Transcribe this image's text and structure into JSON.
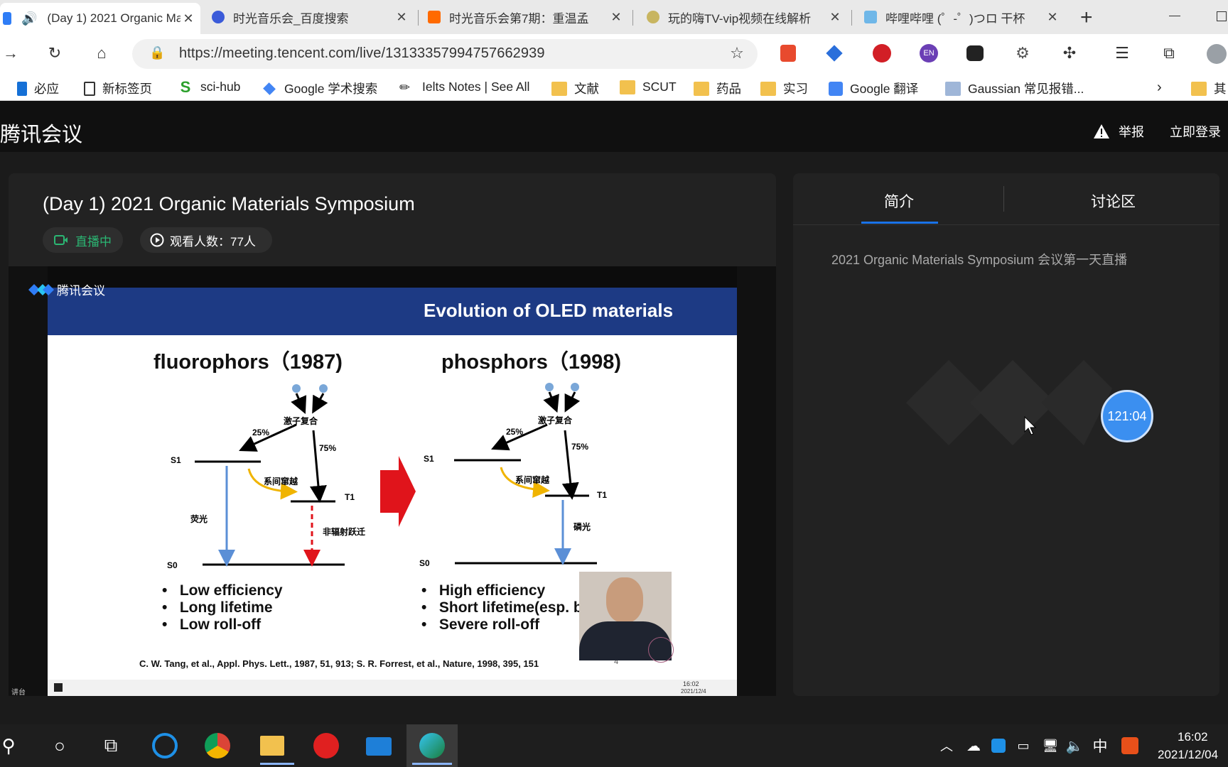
{
  "browser": {
    "tabs": [
      {
        "title": "(Day 1) 2021 Organic Materials Symposium",
        "active": true
      },
      {
        "title": "时光音乐会_百度搜索",
        "active": false
      },
      {
        "title": "时光音乐会第7期：重温孟",
        "active": false
      },
      {
        "title": "玩的嗨TV-vip视频在线解析",
        "active": false
      },
      {
        "title": "哔哩哔哩 (゜-゜)つロ 干杯",
        "active": false
      }
    ],
    "new_tab": "+",
    "url": "https://meeting.tencent.com/live/13133357994757662939",
    "extension_badge": "EN",
    "bookmarks": [
      "必应",
      "新标签页",
      "sci-hub",
      "Google 学术搜索",
      "Ielts Notes | See All",
      "文献",
      "SCUT",
      "药品",
      "实习",
      "Google 翻译",
      "Gaussian 常见报错...",
      "其"
    ]
  },
  "header": {
    "brand": "腾讯会议",
    "report": "举报",
    "login": "立即登录"
  },
  "live": {
    "title": "(Day 1) 2021 Organic Materials Symposium",
    "status": "直播中",
    "viewers": "观看人数：77人"
  },
  "slide": {
    "watermark": "腾讯会议",
    "heading": "Evolution of OLED materials",
    "left": {
      "title": "fluorophors（1987)",
      "bullets": [
        "Low efficiency",
        "Long lifetime",
        "Low roll-off"
      ],
      "labels": {
        "recomb": "激子复合",
        "p25": "25%",
        "p75": "75%",
        "isc": "系间窜越",
        "emission": "荧光",
        "nonrad": "非辐射跃迁",
        "s1": "S1",
        "t1": "T1",
        "s0": "S0"
      }
    },
    "right": {
      "title": "phosphors（1998)",
      "bullets": [
        "High efficiency",
        "Short lifetime(esp. blue",
        "Severe roll-off"
      ],
      "labels": {
        "recomb": "激子复合",
        "p25": "25%",
        "p75": "75%",
        "isc": "系间窜越",
        "emission": "磷光",
        "s1": "S1",
        "t1": "T1",
        "s0": "S0"
      }
    },
    "reference": "C. W. Tang, et al., Appl. Phys. Lett., 1987, 51, 913; S. R. Forrest, et al., Nature, 1998, 395, 151",
    "page": "4",
    "mini_time": "16:02",
    "mini_date": "2021/12/4",
    "sidebar_label": "讲台"
  },
  "side": {
    "tab_intro": "简介",
    "tab_discuss": "讨论区",
    "intro_text": "2021 Organic Materials Symposium 会议第一天直播",
    "timer": "121:04"
  },
  "taskbar": {
    "time": "16:02",
    "date": "2021/12/04",
    "ime": "中"
  },
  "colors": {
    "accent": "#1a73e8",
    "live_green": "#2bb673",
    "slide_blue": "#1d3a84",
    "arrow_red": "#e0141b"
  }
}
